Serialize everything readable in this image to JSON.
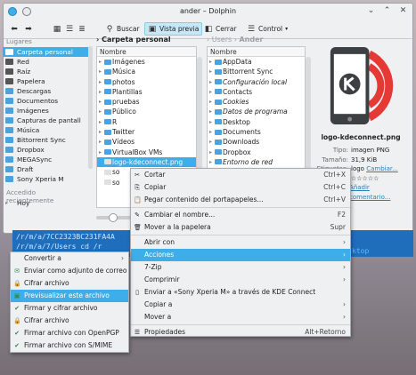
{
  "window": {
    "title": "ander – Dolphin",
    "close_label": "Cerrar",
    "control_label": "Control"
  },
  "toolbar": {
    "search_label": "Buscar",
    "preview_label": "Vista previa"
  },
  "sidebar": {
    "places_header": "Lugares",
    "items": [
      {
        "label": "Carpeta personal",
        "icon": "home-folder-icon"
      },
      {
        "label": "Red",
        "icon": "network-icon"
      },
      {
        "label": "Raíz",
        "icon": "root-icon"
      },
      {
        "label": "Papelera",
        "icon": "trash-icon"
      },
      {
        "label": "Descargas",
        "icon": "downloads-icon"
      },
      {
        "label": "Documentos",
        "icon": "documents-icon"
      },
      {
        "label": "Imágenes",
        "icon": "images-icon"
      },
      {
        "label": "Capturas de pantall",
        "icon": "folder-icon"
      },
      {
        "label": "Música",
        "icon": "music-icon"
      },
      {
        "label": "Bittorrent Sync",
        "icon": "folder-icon"
      },
      {
        "label": "Dropbox",
        "icon": "folder-icon"
      },
      {
        "label": "MEGASync",
        "icon": "folder-icon"
      },
      {
        "label": "Draft",
        "icon": "folder-icon"
      },
      {
        "label": "Sony Xperia M",
        "icon": "phone-icon"
      }
    ],
    "recent_header": "Accedido recientemente",
    "recent_items": [
      {
        "label": "Hoy"
      }
    ]
  },
  "pane_left": {
    "breadcrumb": "Carpeta personal",
    "column_header": "Nombre",
    "rows": [
      {
        "label": "Imágenes"
      },
      {
        "label": "Música"
      },
      {
        "label": "photos"
      },
      {
        "label": "Plantillas"
      },
      {
        "label": "pruebas"
      },
      {
        "label": "Público"
      },
      {
        "label": "R"
      },
      {
        "label": "Twitter"
      },
      {
        "label": "Vídeos"
      },
      {
        "label": "VirtualBox VMs"
      },
      {
        "label": "logo-kdeconnect.png"
      },
      {
        "label": "so"
      },
      {
        "label": "so"
      }
    ]
  },
  "pane_right": {
    "breadcrumb_parent": "Users",
    "breadcrumb_current": "Ander",
    "column_header": "Nombre",
    "rows": [
      {
        "label": "AppData"
      },
      {
        "label": "Bittorrent Sync"
      },
      {
        "label": "Configuración local"
      },
      {
        "label": "Contacts"
      },
      {
        "label": "Cookies"
      },
      {
        "label": "Datos de programa"
      },
      {
        "label": "Desktop"
      },
      {
        "label": "Documents"
      },
      {
        "label": "Downloads"
      },
      {
        "label": "Dropbox"
      },
      {
        "label": "Entorno de red"
      }
    ]
  },
  "preview": {
    "filename": "logo-kdeconnect.png",
    "meta": [
      {
        "key": "Tipo:",
        "value": "imagen PNG"
      },
      {
        "key": "Tamaño:",
        "value": "31,9 KiB"
      },
      {
        "key": "Etiquetas:",
        "value": "logo",
        "link": "Cambiar..."
      },
      {
        "key": "Valoración:",
        "value": ""
      },
      {
        "key": "",
        "value": "",
        "link": "Añadir comentario..."
      }
    ]
  },
  "terminal": {
    "line1": "/r/m/a/7CC2323BC231FA4A",
    "line2": "/r/m/a/7/Users  cd /r",
    "tail": "ktop"
  },
  "context_menu": {
    "items": [
      {
        "label": "Cortar",
        "shortcut": "Ctrl+X",
        "icon": "scissors-icon"
      },
      {
        "label": "Copiar",
        "shortcut": "Ctrl+C",
        "icon": "copy-icon"
      },
      {
        "label": "Pegar contenido del portapapeles...",
        "shortcut": "Ctrl+V",
        "icon": "paste-icon"
      },
      {
        "label": "Cambiar el nombre...",
        "shortcut": "F2",
        "icon": "rename-icon"
      },
      {
        "label": "Mover a la papelera",
        "shortcut": "Supr",
        "icon": "trash-icon"
      },
      {
        "label": "Abrir con",
        "shortcut": "",
        "icon": ""
      },
      {
        "label": "Acciones",
        "shortcut": "",
        "icon": ""
      },
      {
        "label": "7-Zip",
        "shortcut": "",
        "icon": ""
      },
      {
        "label": "Comprimir",
        "shortcut": "",
        "icon": ""
      },
      {
        "label": "Enviar a «Sony Xperia M» a través de KDE Connect",
        "shortcut": "",
        "icon": "kdeconnect-icon"
      },
      {
        "label": "Copiar a",
        "shortcut": "",
        "icon": ""
      },
      {
        "label": "Mover a",
        "shortcut": "",
        "icon": ""
      },
      {
        "label": "Propiedades",
        "shortcut": "Alt+Retorno",
        "icon": "properties-icon"
      }
    ]
  },
  "actions_submenu": {
    "items": [
      {
        "label": "Convertir a",
        "icon": ""
      },
      {
        "label": "Enviar como adjunto de correo",
        "icon": "mail-icon"
      },
      {
        "label": "Cifrar archivo",
        "icon": "encrypt-icon"
      },
      {
        "label": "Previsualizar este archivo",
        "icon": "preview-icon"
      },
      {
        "label": "Firmar y cifrar archivo",
        "icon": "sign-encrypt-icon"
      },
      {
        "label": "Cifrar archivo",
        "icon": "encrypt-icon"
      },
      {
        "label": "Firmar archivo con OpenPGP",
        "icon": "sign-icon"
      },
      {
        "label": "Firmar archivo con S/MIME",
        "icon": "sign-icon"
      }
    ]
  },
  "colors": {
    "selection": "#3daee9",
    "window_bg": "#eff0f1",
    "terminal_bg": "#1e6ebc",
    "logo_red": "#e53935"
  }
}
